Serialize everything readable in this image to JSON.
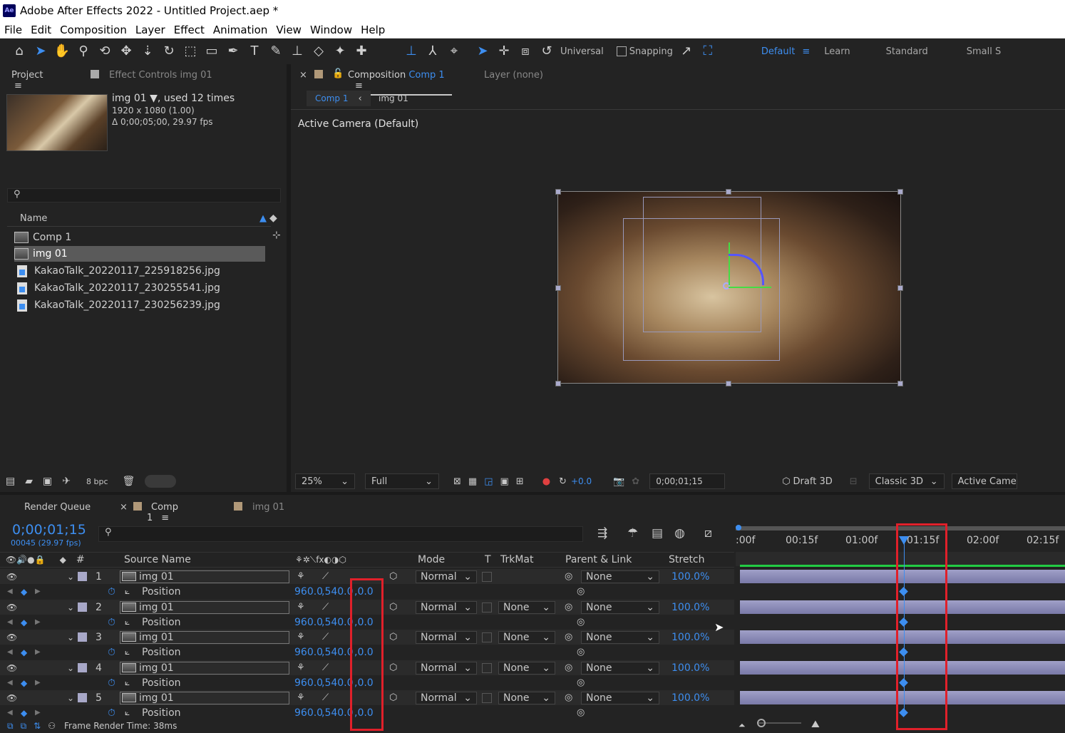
{
  "window": {
    "title": "Adobe After Effects 2022 - Untitled Project.aep *",
    "logo": "Ae"
  },
  "menu": [
    "File",
    "Edit",
    "Composition",
    "Layer",
    "Effect",
    "Animation",
    "View",
    "Window",
    "Help"
  ],
  "toolbar": {
    "universal": "Universal",
    "snapping": "Snapping",
    "workspaces": [
      "Default",
      "Learn",
      "Standard",
      "Small S"
    ]
  },
  "project_panel": {
    "tab_project": "Project",
    "tab_effect_controls": "Effect Controls img 01",
    "item_name": "img 01",
    "item_usage": ", used 12 times",
    "item_dims": "1920 x 1080 (1.00)",
    "item_duration": "Δ 0;00;05;00, 29.97 fps",
    "search_placeholder": "",
    "column_name": "Name",
    "items": [
      "Comp 1",
      "img 01",
      "KakaoTalk_20220117_225918256.jpg",
      "KakaoTalk_20220117_230255541.jpg",
      "KakaoTalk_20220117_230256239.jpg"
    ],
    "bpc": "8 bpc"
  },
  "comp_panel": {
    "tab_close": "×",
    "tab_label": "Composition",
    "tab_comp": "Comp 1",
    "tab_layer": "Layer (none)",
    "breadcrumb_comp": "Comp 1",
    "breadcrumb_layer": "img 01",
    "camera_label": "Active Camera (Default)",
    "zoom": "25%",
    "resolution": "Full",
    "exposure": "+0.0",
    "timecode": "0;00;01;15",
    "draft3d": "Draft 3D",
    "renderer": "Classic 3D",
    "view": "Active Camera"
  },
  "timeline": {
    "tab_render_queue": "Render Queue",
    "tab_comp": "Comp 1",
    "tab_img": "img 01",
    "current_time": "0;00;01;15",
    "frame_info": "00045 (29.97 fps)",
    "col_source_name": "Source Name",
    "col_mode": "Mode",
    "col_t": "T",
    "col_trkmat": "TrkMat",
    "col_parent": "Parent & Link",
    "col_stretch": "Stretch",
    "ruler": [
      ":00f",
      "00:15f",
      "01:00f",
      "01:15f",
      "02:00f",
      "02:15f"
    ],
    "playhead_fraction": 0.51,
    "layers": [
      {
        "num": "1",
        "name": "img 01",
        "mode": "Normal",
        "trkmat": "",
        "parent": "None",
        "stretch": "100.0%",
        "prop": "Position",
        "px": "960.0",
        "py": ",540.0",
        "pz": ",0.0"
      },
      {
        "num": "2",
        "name": "img 01",
        "mode": "Normal",
        "trkmat": "None",
        "parent": "None",
        "stretch": "100.0%",
        "prop": "Position",
        "px": "960.0",
        "py": ",540.0",
        "pz": ",0.0"
      },
      {
        "num": "3",
        "name": "img 01",
        "mode": "Normal",
        "trkmat": "None",
        "parent": "None",
        "stretch": "100.0%",
        "prop": "Position",
        "px": "960.0",
        "py": ",540.0",
        "pz": ",0.0"
      },
      {
        "num": "4",
        "name": "img 01",
        "mode": "Normal",
        "trkmat": "None",
        "parent": "None",
        "stretch": "100.0%",
        "prop": "Position",
        "px": "960.0",
        "py": ",540.0",
        "pz": ",0.0"
      },
      {
        "num": "5",
        "name": "img 01",
        "mode": "Normal",
        "trkmat": "None",
        "parent": "None",
        "stretch": "100.0%",
        "prop": "Position",
        "px": "960.0",
        "py": ",540.0",
        "pz": ",0.0"
      }
    ],
    "frame_render_time": "Frame Render Time:",
    "frame_render_value": "38ms"
  },
  "colors": {
    "accent": "#3d8ef0",
    "highlight": "#e0202a",
    "layer_bar": "#8888b4"
  }
}
